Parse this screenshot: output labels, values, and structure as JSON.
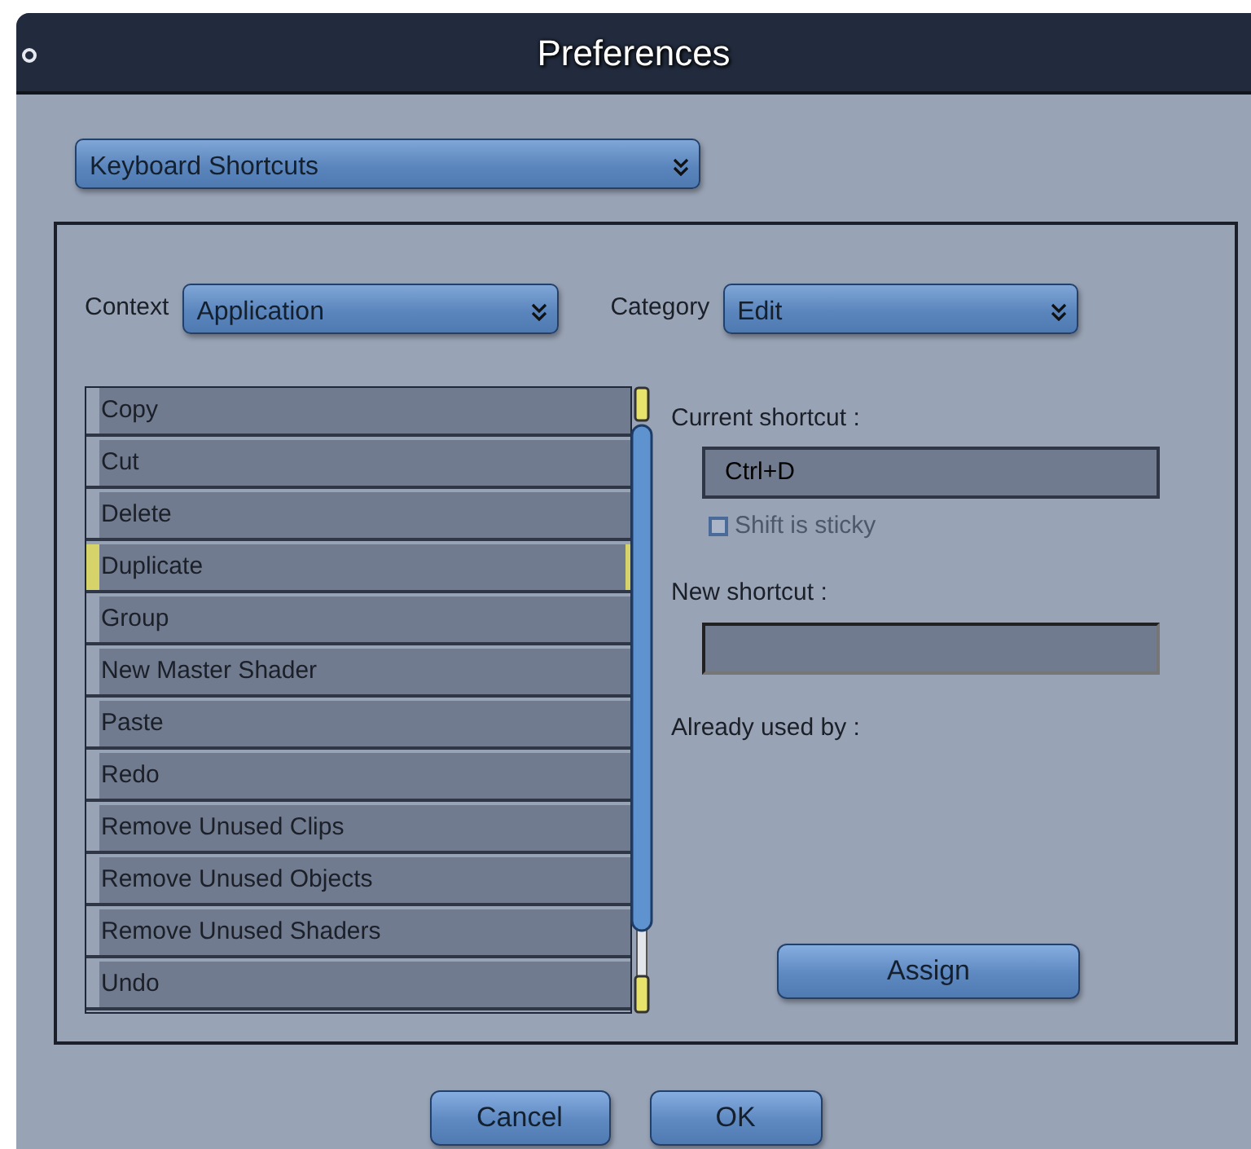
{
  "window": {
    "title": "Preferences"
  },
  "section_dropdown": {
    "value": "Keyboard Shortcuts"
  },
  "context": {
    "label": "Context",
    "value": "Application"
  },
  "category": {
    "label": "Category",
    "value": "Edit"
  },
  "commands": [
    {
      "label": "Copy",
      "selected": false
    },
    {
      "label": "Cut",
      "selected": false
    },
    {
      "label": "Delete",
      "selected": false
    },
    {
      "label": "Duplicate",
      "selected": true
    },
    {
      "label": "Group",
      "selected": false
    },
    {
      "label": "New Master Shader",
      "selected": false
    },
    {
      "label": "Paste",
      "selected": false
    },
    {
      "label": "Redo",
      "selected": false
    },
    {
      "label": "Remove Unused Clips",
      "selected": false
    },
    {
      "label": "Remove Unused Objects",
      "selected": false
    },
    {
      "label": "Remove Unused Shaders",
      "selected": false
    },
    {
      "label": "Undo",
      "selected": false
    }
  ],
  "current_shortcut": {
    "label": "Current shortcut :",
    "value": "Ctrl+D"
  },
  "shift_sticky": {
    "label": "Shift is sticky",
    "checked": false,
    "disabled": true
  },
  "new_shortcut": {
    "label": "New shortcut :"
  },
  "already_used": {
    "label": "Already used by :"
  },
  "assign_button": "Assign",
  "buttons": [
    "Cancel",
    "OK"
  ]
}
